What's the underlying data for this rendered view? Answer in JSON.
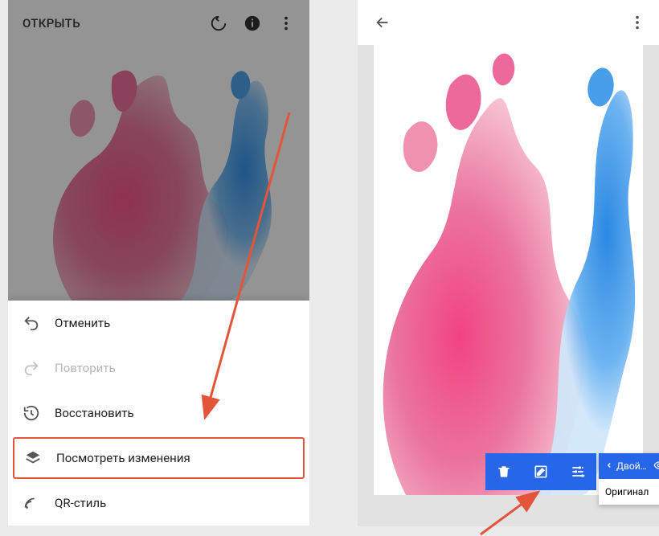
{
  "left": {
    "open_label": "ОТКРЫТЬ",
    "sheet": {
      "undo": "Отменить",
      "redo": "Повторить",
      "revert": "Восстановить",
      "view": "Посмотреть изменения",
      "qr": "QR-стиль"
    }
  },
  "right": {
    "layers": {
      "double_exposure": "Двойная экс...",
      "original": "Оригинал"
    }
  },
  "colors": {
    "accent_blue": "#2765E9",
    "highlight_red": "#E3553A"
  }
}
